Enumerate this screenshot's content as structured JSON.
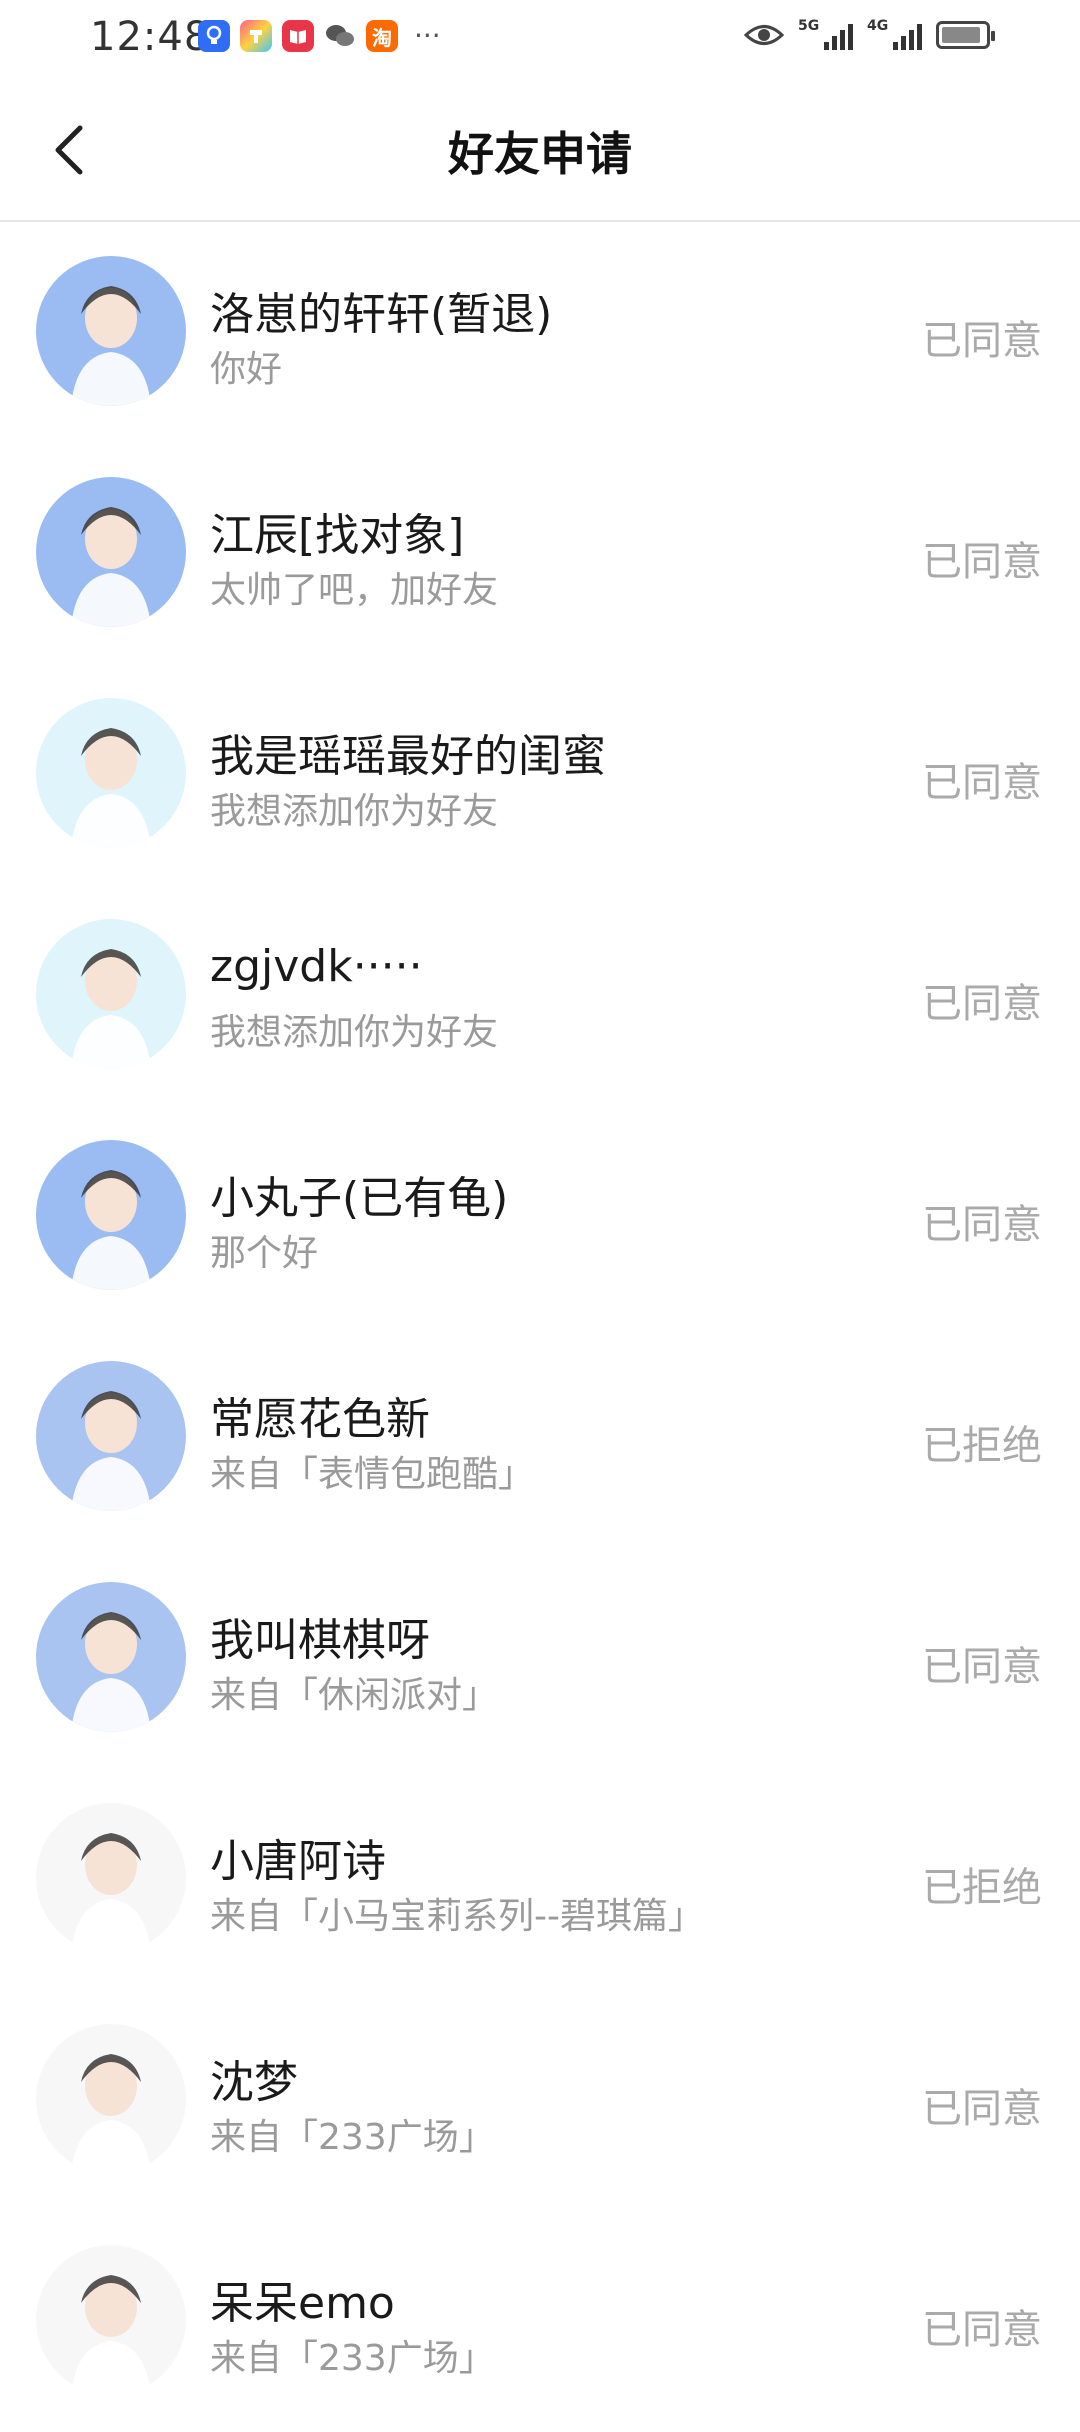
{
  "status_bar": {
    "time": "12:48",
    "more": "···",
    "network_tags": [
      "5G",
      "4G"
    ],
    "app_icons": [
      {
        "name": "bulb-app-icon",
        "color": "#2f6df6"
      },
      {
        "name": "colorful-app-icon",
        "color": "#f5a623"
      },
      {
        "name": "book-app-icon",
        "color": "#e8354a"
      },
      {
        "name": "wechat-icon",
        "color": "#444444"
      },
      {
        "name": "taobao-icon",
        "color": "#ff6a00",
        "label": "淘"
      }
    ]
  },
  "header": {
    "title": "好友申请"
  },
  "requests": [
    {
      "name": "洛崽的轩轩(暂退)",
      "message": "你好",
      "status": "已同意",
      "avatar_bg": "#9bbcf2"
    },
    {
      "name": "江辰[找对象]",
      "message": "太帅了吧，加好友",
      "status": "已同意",
      "avatar_bg": "#9bbcf2"
    },
    {
      "name": "我是瑶瑶最好的闺蜜",
      "message": "我想添加你为好友",
      "status": "已同意",
      "avatar_bg": "#dff5fb"
    },
    {
      "name": "zgjvdk·····",
      "message": "我想添加你为好友",
      "status": "已同意",
      "avatar_bg": "#dff5fb"
    },
    {
      "name": "小丸子(已有龟)",
      "message": "那个好",
      "status": "已同意",
      "avatar_bg": "#9bbcf2"
    },
    {
      "name": "常愿花色新",
      "message": "来自「表情包跑酷」",
      "status": "已拒绝",
      "avatar_bg": "#a9c4f0"
    },
    {
      "name": "我叫棋棋呀",
      "message": "来自「休闲派对」",
      "status": "已同意",
      "avatar_bg": "#a9c4f0"
    },
    {
      "name": "小唐阿诗",
      "message": "来自「小马宝莉系列--碧琪篇」",
      "status": "已拒绝",
      "avatar_bg": "#f7f7f7"
    },
    {
      "name": "沈梦",
      "message": "来自「233广场」",
      "status": "已同意",
      "avatar_bg": "#f7f7f7"
    },
    {
      "name": "呆呆emo",
      "message": "来自「233广场」",
      "status": "已同意",
      "avatar_bg": "#f7f7f7"
    }
  ]
}
